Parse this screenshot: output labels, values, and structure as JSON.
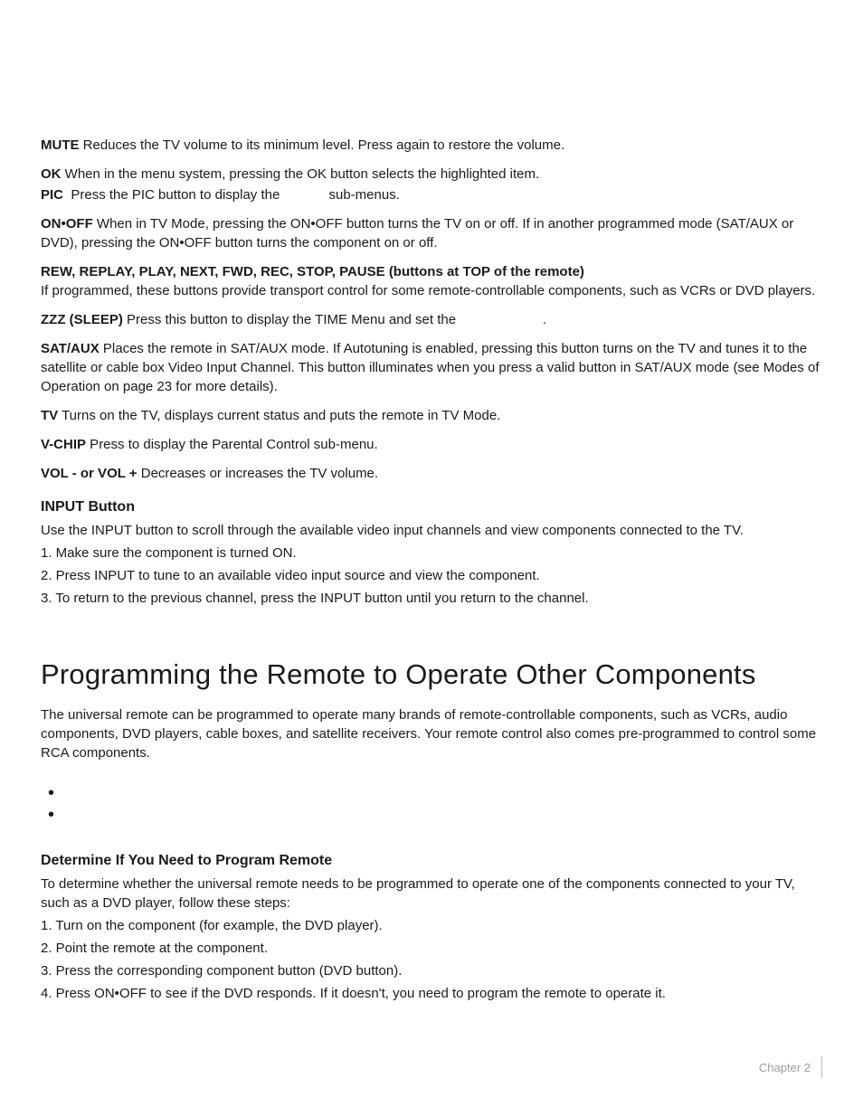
{
  "entries": [
    {
      "term": "MUTE",
      "text": " Reduces the TV volume to its minimum level. Press again to restore the volume."
    },
    {
      "term": "OK",
      "text": " When in the menu system, pressing the OK button selects the highlighted item."
    },
    {
      "term": "PIC",
      "text": "  Press the PIC button to display the             sub-menus."
    },
    {
      "term": "ON•OFF",
      "text": " When in TV Mode, pressing the ON•OFF button turns the TV on or off. If in another programmed mode (SAT/AUX or DVD), pressing the ON•OFF button turns the component on or off."
    },
    {
      "term": "REW, REPLAY, PLAY, NEXT, FWD, REC, STOP, PAUSE (buttons at TOP of the remote)",
      "text": " If programmed, these buttons provide transport control for some remote-controllable components, such as VCRs or DVD players.",
      "break_after_term": true
    },
    {
      "term": "ZZZ (SLEEP)",
      "text": " Press this button to display the TIME Menu and set the                       ."
    },
    {
      "term": "SAT/AUX",
      "text": " Places the remote in SAT/AUX mode. If Autotuning is enabled, pressing this button turns on the TV and tunes it to the satellite or cable box Video Input Channel. This button illuminates when you press a valid button in SAT/AUX mode (see Modes of Operation on page 23 for more details)."
    },
    {
      "term": "TV",
      "text": " Turns on the TV, displays current status and puts the remote in TV Mode."
    },
    {
      "term": "V-CHIP",
      "text": " Press to display the Parental Control sub-menu."
    },
    {
      "term": "VOL - or VOL +",
      "text": " Decreases or increases the TV volume."
    }
  ],
  "input_button": {
    "heading": "INPUT Button",
    "intro": "Use the INPUT button to scroll through the available video input channels and view components connected to the TV.",
    "steps": [
      "1. Make sure the component is turned ON.",
      "2. Press INPUT to tune to an available video input source and view the component.",
      "3. To return to the previous channel, press the INPUT button until you return to the channel."
    ]
  },
  "programming": {
    "heading": "Programming the Remote to Operate Other Components",
    "intro": "The universal remote can be programmed to operate many brands of remote-controllable components, such as VCRs, audio components, DVD players, cable boxes, and satellite receivers. Your remote control also comes pre-programmed to control some RCA components.",
    "bullets": [
      "•",
      "•"
    ]
  },
  "determine": {
    "heading": "Determine If You Need to Program Remote",
    "intro": "To determine whether the universal remote needs to be programmed to operate one of the components connected to your TV, such as a DVD player, follow these steps:",
    "steps": [
      "1. Turn on the component (for example, the DVD player).",
      "2. Point the remote at the component.",
      "3. Press the corresponding component button (DVD button).",
      "4. Press ON•OFF to see if the DVD responds. If it doesn't, you need to program the remote to operate it."
    ]
  },
  "footer": {
    "chapter": "Chapter 2"
  }
}
